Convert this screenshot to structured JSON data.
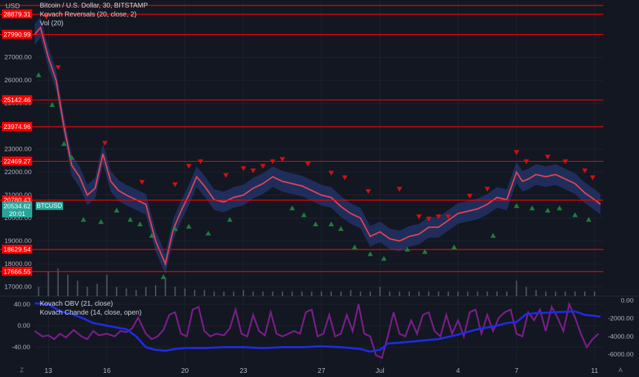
{
  "currency": "USD",
  "legend": {
    "title": "Bitcoin / U.S. Dollar, 30, BITSTAMP",
    "indicator1": "Kovach Reversals (20, close, 2)",
    "indicator2": "Vol (20)"
  },
  "osc_legend": {
    "line1": "Kovach OBV (21, close)",
    "line2": "Kovach Chande (14, close, open)"
  },
  "colors": {
    "background": "#131722",
    "grid": "#1e222d",
    "hline": "#ff0000",
    "candle_band": "#2a3f8a",
    "price_line": "#e0454f",
    "up_arrow": "#1b7f3a",
    "down_arrow": "#d01010",
    "obv_line": "#1f2be0",
    "chande_line": "#7b1e8a",
    "current_price_bg": "#26a69a"
  },
  "bottom_icons": {
    "left": "Z",
    "right": "A"
  },
  "chart_data": [
    {
      "type": "line",
      "name": "price",
      "ylim": [
        16600,
        29500
      ],
      "xlim": [
        12.35,
        11.45
      ],
      "y_ticks": [
        17000,
        18000,
        19000,
        20000,
        21000,
        22000,
        23000,
        24000,
        25000,
        26000,
        27000,
        28000
      ],
      "y_tick_labels": [
        "17000.00",
        "18000.00",
        "19000.00",
        "20000.00",
        "21000.00",
        "22000.00",
        "23000.00",
        "24000.00",
        "25000.00",
        "26000.00",
        "27000.00",
        "28000.00"
      ],
      "x_ticks": [
        13,
        16,
        20,
        23,
        27,
        30,
        34,
        37,
        41
      ],
      "x_tick_labels": [
        "13",
        "16",
        "20",
        "23",
        "27",
        "Jul",
        "4",
        "7",
        "11"
      ],
      "horizontal_levels": [
        29800,
        28879.31,
        27990.99,
        25142.46,
        23974.96,
        22469.27,
        20780.43,
        18629.54,
        17666.55
      ],
      "horizontal_level_labels": [
        "",
        "28879.31",
        "27990.99",
        "25142.46",
        "23974.96",
        "22469.27",
        "20780.43",
        "18629.54",
        "17666.55"
      ],
      "current_price": 20534.62,
      "current_price_label": "20534.62",
      "countdown": "20:01",
      "symbol_tag": "BTCUSD",
      "x": [
        12.3,
        12.6,
        13.0,
        13.4,
        13.8,
        14.2,
        14.6,
        15.0,
        15.4,
        15.8,
        16.2,
        16.6,
        17.0,
        17.5,
        18.0,
        18.5,
        19.0,
        19.4,
        19.8,
        20.2,
        20.6,
        21.0,
        21.5,
        22.0,
        22.5,
        23.0,
        23.5,
        24.0,
        24.5,
        25.0,
        25.5,
        26.0,
        26.5,
        27.0,
        27.5,
        28.0,
        28.5,
        29.0,
        29.5,
        30.0,
        30.5,
        31.0,
        31.5,
        32.0,
        32.5,
        33.0,
        33.5,
        34.0,
        34.5,
        35.0,
        35.5,
        36.0,
        36.5,
        37.0,
        37.3,
        37.6,
        38.0,
        38.5,
        39.0,
        39.5,
        40.0,
        40.5,
        41.0,
        41.3
      ],
      "y": [
        28000,
        28300,
        27000,
        26000,
        24000,
        22300,
        21800,
        21000,
        21300,
        22800,
        21600,
        21200,
        21000,
        20800,
        20600,
        19000,
        18000,
        19500,
        20300,
        21000,
        21800,
        21400,
        20800,
        20700,
        20900,
        21000,
        21300,
        21500,
        21800,
        21600,
        21500,
        21400,
        21200,
        21000,
        20900,
        20500,
        20200,
        20000,
        19200,
        19400,
        19100,
        19000,
        19200,
        19300,
        19600,
        19600,
        19900,
        20200,
        20300,
        20400,
        20600,
        20900,
        20800,
        22000,
        21600,
        21700,
        21900,
        21800,
        21900,
        21700,
        21500,
        21100,
        20800,
        20600
      ],
      "reversals_down": [
        [
          12.9,
          28500
        ],
        [
          13.5,
          26300
        ],
        [
          15.9,
          23000
        ],
        [
          17.8,
          21300
        ],
        [
          19.5,
          21200
        ],
        [
          20.2,
          22000
        ],
        [
          20.8,
          22200
        ],
        [
          22.1,
          21600
        ],
        [
          23.0,
          21900
        ],
        [
          23.5,
          21800
        ],
        [
          24.0,
          22000
        ],
        [
          24.5,
          22200
        ],
        [
          25.0,
          22300
        ],
        [
          26.3,
          22100
        ],
        [
          27.5,
          21700
        ],
        [
          28.2,
          21500
        ],
        [
          29.4,
          20900
        ],
        [
          31.0,
          21000
        ],
        [
          32.0,
          19800
        ],
        [
          32.5,
          19700
        ],
        [
          33.0,
          19800
        ],
        [
          33.5,
          19800
        ],
        [
          34.6,
          20700
        ],
        [
          35.5,
          21000
        ],
        [
          37.0,
          22600
        ],
        [
          37.5,
          22200
        ],
        [
          38.6,
          22400
        ],
        [
          39.5,
          22200
        ],
        [
          40.5,
          21800
        ],
        [
          40.9,
          21500
        ]
      ],
      "reversals_up": [
        [
          12.5,
          26500
        ],
        [
          13.2,
          25200
        ],
        [
          13.8,
          23500
        ],
        [
          14.2,
          22900
        ],
        [
          14.8,
          20200
        ],
        [
          15.7,
          20100
        ],
        [
          16.5,
          20600
        ],
        [
          17.2,
          20200
        ],
        [
          17.7,
          20000
        ],
        [
          18.3,
          19500
        ],
        [
          18.9,
          17700
        ],
        [
          19.5,
          19800
        ],
        [
          20.2,
          19900
        ],
        [
          21.2,
          19600
        ],
        [
          22.3,
          20200
        ],
        [
          25.5,
          20700
        ],
        [
          26.1,
          20400
        ],
        [
          26.7,
          20000
        ],
        [
          27.5,
          20000
        ],
        [
          28.0,
          19800
        ],
        [
          28.7,
          19000
        ],
        [
          29.5,
          18700
        ],
        [
          30.2,
          18500
        ],
        [
          31.4,
          18900
        ],
        [
          32.3,
          18800
        ],
        [
          33.8,
          19000
        ],
        [
          35.8,
          19500
        ],
        [
          37.0,
          20800
        ],
        [
          37.8,
          20700
        ],
        [
          38.6,
          20600
        ],
        [
          39.2,
          20700
        ],
        [
          40.0,
          20400
        ],
        [
          40.7,
          20200
        ]
      ]
    },
    {
      "type": "bar",
      "name": "volume",
      "x": [
        12.5,
        13.0,
        13.5,
        14.0,
        14.5,
        15.0,
        15.5,
        16.0,
        16.5,
        17.0,
        17.5,
        18.0,
        18.5,
        19.0,
        19.5,
        20.0,
        20.5,
        21.0,
        21.5,
        22.0,
        22.5,
        23.0,
        23.5,
        24.0,
        24.5,
        25.0,
        25.5,
        26.0,
        26.5,
        27.0,
        27.5,
        28.0,
        28.5,
        29.0,
        29.5,
        30.0,
        30.5,
        31.0,
        31.5,
        32.0,
        32.5,
        33.0,
        33.5,
        34.0,
        34.5,
        35.0,
        35.5,
        36.0,
        36.5,
        37.0,
        37.5,
        38.0,
        38.5,
        39.0,
        39.5,
        40.0,
        40.5,
        41.0
      ],
      "values": [
        0.3,
        0.8,
        0.9,
        0.7,
        0.5,
        0.3,
        0.4,
        0.7,
        0.3,
        0.25,
        0.2,
        0.3,
        0.35,
        0.6,
        0.3,
        0.25,
        0.2,
        0.2,
        0.15,
        0.15,
        0.15,
        0.2,
        0.15,
        0.15,
        0.15,
        0.15,
        0.15,
        0.15,
        0.15,
        0.15,
        0.15,
        0.15,
        0.2,
        0.15,
        0.15,
        0.3,
        0.15,
        0.15,
        0.15,
        0.15,
        0.15,
        0.15,
        0.15,
        0.15,
        0.15,
        0.15,
        0.15,
        0.15,
        0.15,
        0.5,
        0.3,
        0.2,
        0.15,
        0.15,
        0.15,
        0.15,
        0.15,
        0.15
      ],
      "ylim": [
        0,
        1
      ]
    },
    {
      "type": "line",
      "name": "Kovach OBV (21, close)",
      "axis": "right",
      "ylim": [
        -7000,
        500
      ],
      "y_ticks": [
        0,
        -2000,
        -4000,
        -6000
      ],
      "y_tick_labels": [
        "0.00",
        "-2000.00",
        "-4000.00",
        "-6000.00"
      ],
      "x": [
        12.3,
        13.0,
        13.6,
        14.2,
        14.8,
        15.3,
        16.0,
        16.5,
        17.0,
        17.5,
        18.0,
        18.5,
        19.0,
        19.5,
        20.0,
        21.0,
        22.0,
        23.0,
        24.0,
        25.0,
        26.0,
        27.0,
        28.0,
        29.0,
        29.5,
        30.0,
        30.4,
        31.0,
        32.0,
        33.0,
        34.0,
        35.0,
        36.0,
        36.5,
        37.0,
        37.5,
        38.0,
        39.0,
        40.0,
        40.5,
        41.0,
        41.3
      ],
      "y": [
        -300,
        -400,
        -1200,
        -1500,
        -2000,
        -2500,
        -2800,
        -3000,
        -3200,
        -4000,
        -5200,
        -5500,
        -5600,
        -5400,
        -5300,
        -5300,
        -5200,
        -5200,
        -5300,
        -5200,
        -5200,
        -5100,
        -5200,
        -5400,
        -5700,
        -5500,
        -4800,
        -4700,
        -4500,
        -4300,
        -3800,
        -3200,
        -2800,
        -2500,
        -2400,
        -1500,
        -1400,
        -1300,
        -1200,
        -1600,
        -1700,
        -1800
      ]
    },
    {
      "type": "line",
      "name": "Kovach Chande (14, close, open)",
      "axis": "left",
      "ylim": [
        -70,
        55
      ],
      "y_ticks": [
        40,
        0,
        -40
      ],
      "y_tick_labels": [
        "40.00",
        "0.00",
        "-40.00"
      ],
      "x": [
        12.3,
        12.7,
        13.0,
        13.3,
        13.6,
        13.9,
        14.3,
        14.7,
        15.0,
        15.3,
        15.6,
        16.0,
        16.4,
        16.7,
        17.0,
        17.3,
        17.6,
        18.0,
        18.3,
        18.6,
        18.9,
        19.2,
        19.5,
        19.8,
        20.1,
        20.4,
        20.7,
        21.0,
        21.3,
        21.6,
        22.0,
        22.3,
        22.6,
        22.9,
        23.2,
        23.5,
        23.8,
        24.1,
        24.4,
        24.7,
        25.0,
        25.3,
        25.6,
        25.9,
        26.2,
        26.5,
        26.8,
        27.1,
        27.4,
        27.7,
        28.0,
        28.3,
        28.6,
        28.9,
        29.2,
        29.5,
        29.8,
        30.1,
        30.4,
        30.7,
        31.0,
        31.3,
        31.6,
        31.9,
        32.2,
        32.5,
        32.8,
        33.1,
        33.4,
        33.7,
        34.0,
        34.3,
        34.6,
        34.9,
        35.2,
        35.5,
        35.8,
        36.1,
        36.4,
        36.7,
        37.0,
        37.3,
        37.6,
        37.9,
        38.2,
        38.5,
        38.8,
        39.1,
        39.4,
        39.7,
        40.0,
        40.3,
        40.6,
        40.9,
        41.2
      ],
      "y": [
        -10,
        -20,
        -18,
        -25,
        -15,
        -22,
        -8,
        -20,
        -25,
        -10,
        -18,
        -15,
        -20,
        -10,
        -12,
        -5,
        15,
        -15,
        -25,
        -20,
        -8,
        20,
        25,
        -15,
        -20,
        30,
        35,
        -10,
        -20,
        -15,
        -18,
        -5,
        30,
        -15,
        -20,
        20,
        -10,
        -18,
        25,
        -15,
        -20,
        -15,
        -10,
        -15,
        25,
        30,
        -20,
        -15,
        20,
        -20,
        -15,
        20,
        -10,
        40,
        -15,
        -20,
        -55,
        -60,
        -20,
        25,
        -15,
        -20,
        10,
        -15,
        20,
        25,
        -10,
        -20,
        20,
        -15,
        10,
        -20,
        25,
        30,
        -15,
        20,
        -10,
        15,
        25,
        30,
        -15,
        -20,
        25,
        10,
        30,
        -10,
        35,
        15,
        -10,
        40,
        15,
        -15,
        -40,
        -25,
        -15
      ]
    }
  ]
}
